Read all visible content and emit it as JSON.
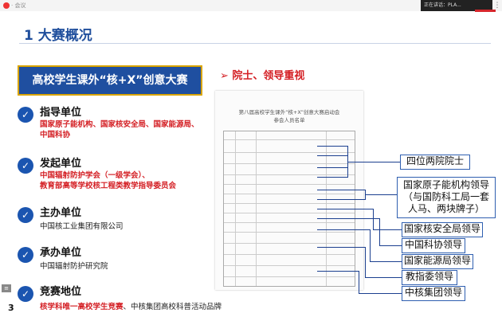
{
  "topbar": {
    "left_text": "· 会议",
    "right_text": "正在讲话：PLA..."
  },
  "header": {
    "title": "1 大赛概况"
  },
  "banner": {
    "text": "高校学生课外“核+X”创意大赛"
  },
  "sections": [
    {
      "heading": "指导单位",
      "lines": [
        "国家原子能机构、国家核安全局、国家能源局、",
        "中国科协"
      ],
      "style": "red"
    },
    {
      "heading": "发起单位",
      "lines": [
        "中国辐射防护学会（一级学会）、",
        "教育部高等学校核工程类教学指导委员会"
      ],
      "style": "red"
    },
    {
      "heading": "主办单位",
      "lines": [
        "中国核工业集团有限公司"
      ],
      "style": "black"
    },
    {
      "heading": "承办单位",
      "lines": [
        "中国辐射防护研究院"
      ],
      "style": "black"
    },
    {
      "heading": "竞赛地位",
      "lines_rich": {
        "red": "核学科唯一高校学生竞赛",
        "black": "、中核集团高校科普活动品牌"
      },
      "style": "mixed"
    }
  ],
  "right": {
    "heading": "➢ 院士、领导重视",
    "document": {
      "title_line1": "第八届高校学生课外“核+X”创意大赛启动会",
      "title_line2": "参会人员名单"
    },
    "labels": [
      "四位两院院士",
      "国家原子能机构领导",
      "（与国防科工局一套",
      "人马、两块牌子）",
      "国家核安全局领导",
      "中国科协领导",
      "国家能源局领导",
      "教指委领导",
      "中核集团领导"
    ]
  },
  "footer": {
    "page_number": "3",
    "menu_icon": "menu-icon"
  }
}
